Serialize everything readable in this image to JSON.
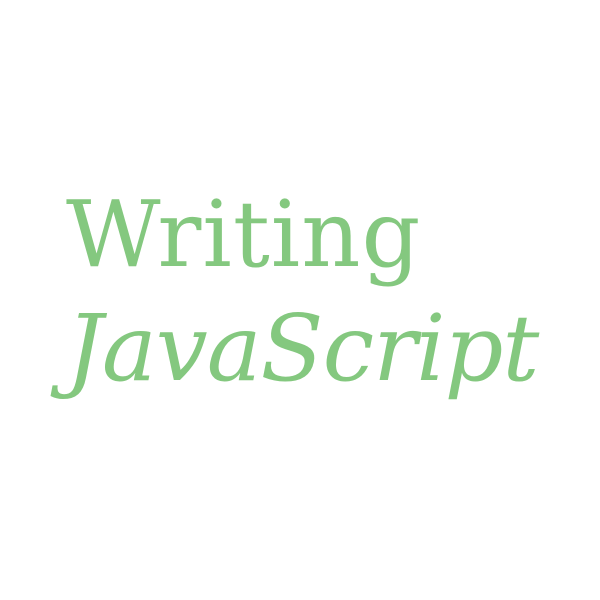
{
  "title": {
    "line1": "Writing",
    "line2": "JavaScript"
  },
  "colors": {
    "background": "#ffffff",
    "text": "#84c87f"
  }
}
